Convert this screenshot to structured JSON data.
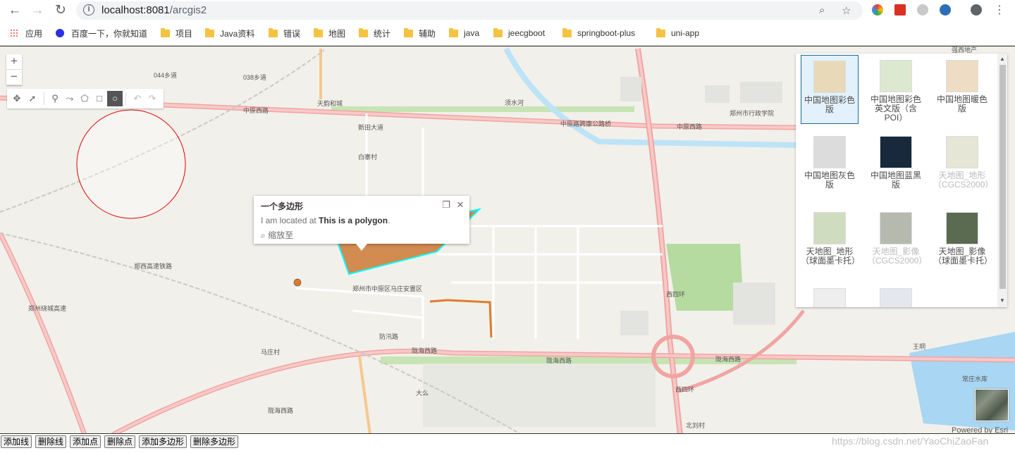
{
  "browser": {
    "url_host": "localhost:8081",
    "url_path": "/arcgis2"
  },
  "bookmarks": [
    {
      "label": "应用",
      "icon": "apps-grid-icon"
    },
    {
      "label": "百度一下，你就知道",
      "icon": "baidu-paw-icon"
    },
    {
      "label": "项目",
      "icon": "folder-icon"
    },
    {
      "label": "Java资料",
      "icon": "folder-icon"
    },
    {
      "label": "错误",
      "icon": "folder-icon"
    },
    {
      "label": "地图",
      "icon": "folder-icon"
    },
    {
      "label": "统计",
      "icon": "folder-icon"
    },
    {
      "label": "辅助",
      "icon": "folder-icon"
    },
    {
      "label": "java",
      "icon": "folder-icon"
    },
    {
      "label": "jeecgboot",
      "icon": "folder-icon"
    },
    {
      "label": "springboot-plus",
      "icon": "folder-icon"
    },
    {
      "label": "uni-app",
      "icon": "folder-icon"
    }
  ],
  "map": {
    "zoom_in": "+",
    "zoom_out": "−",
    "labels": {
      "l1": "044乡道",
      "l2": "038乡道",
      "l3": "天韵和城",
      "l4": "中原西路",
      "l5": "新田大道",
      "l6": "白寨村",
      "l7": "须水河",
      "l8": "中原路跨康公路桥",
      "l9": "中原西路",
      "l10": "郑州市行政学院",
      "l11": "郑西高速铁路",
      "l12": "郑州绕城高速",
      "l13": "郑州市中原区马庄安置区",
      "l14": "防汛路",
      "l15": "马庄村",
      "l16": "陇海西路",
      "l17": "陇海西路",
      "l18": "陇海西路",
      "l19": "西四环",
      "l20": "常庄水库",
      "l21": "王垌",
      "l22": "大么",
      "l23": "北刘村",
      "l24": "陇海西路",
      "l25": "西四环",
      "l26": "强西地产"
    },
    "colors": {
      "polygon_fill": "#d28b51",
      "polygon_outline": "#00ffff",
      "circle_stroke": "#e00000",
      "line": "#e07b2c",
      "point": "#e07b2c"
    }
  },
  "popup": {
    "title": "一个多边形",
    "text_prefix": "I am located at ",
    "text_bold": "This is a polygon",
    "text_suffix": ".",
    "zoom_label": "缩放至"
  },
  "gallery": [
    {
      "label": "中国地图彩色版",
      "selected": true,
      "disabled": false,
      "thumb": "#e8d9b8"
    },
    {
      "label": "中国地图彩色英文版（含POI）",
      "selected": false,
      "disabled": false,
      "thumb": "#dde8d0"
    },
    {
      "label": "中国地图暖色版",
      "selected": false,
      "disabled": false,
      "thumb": "#efdcc4"
    },
    {
      "label": "中国地图灰色版",
      "selected": false,
      "disabled": false,
      "thumb": "#dcdcdc"
    },
    {
      "label": "中国地图蓝黑版",
      "selected": false,
      "disabled": false,
      "thumb": "#17293b"
    },
    {
      "label": "天地图_地形（CGCS2000）",
      "selected": false,
      "disabled": true,
      "thumb": "#e6e6d6"
    },
    {
      "label": "天地图_地形（球面墨卡托）",
      "selected": false,
      "disabled": false,
      "thumb": "#cfdcc0"
    },
    {
      "label": "天地图_影像（CGCS2000）",
      "selected": false,
      "disabled": true,
      "thumb": "#b5b9ae"
    },
    {
      "label": "天地图_影像（球面墨卡托）",
      "selected": false,
      "disabled": false,
      "thumb": "#5a6b52"
    }
  ],
  "attribution": "Powered by Esri",
  "buttons": [
    "添加线",
    "删除线",
    "添加点",
    "删除点",
    "添加多边形",
    "删除多边形"
  ],
  "watermark": "https://blog.csdn.net/YaoChiZaoFan"
}
